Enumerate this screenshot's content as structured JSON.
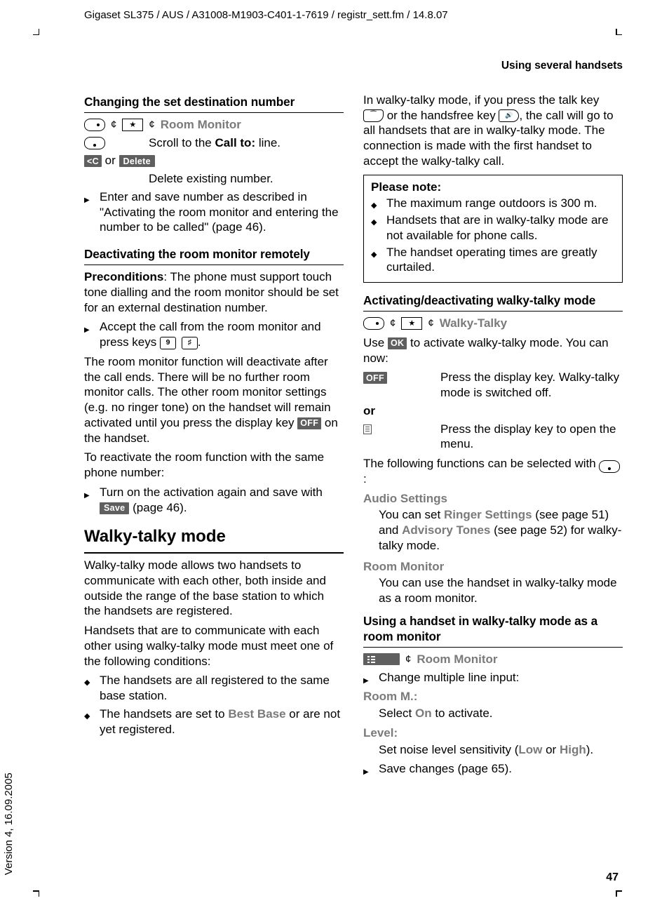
{
  "meta": {
    "topline": "Gigaset SL375 / AUS / A31008-M1903-C401-1-7619 / registr_sett.fm / 14.8.07",
    "sideline": "Version 4, 16.09.2005",
    "running_head": "Using several handsets",
    "page_number": "47"
  },
  "left": {
    "h_change": "Changing the set destination number",
    "nav1_dest": "Room Monitor",
    "scroll_text_a": "Scroll to the ",
    "scroll_text_b": "Call to:",
    "scroll_text_c": " line.",
    "or": " or ",
    "soft_delete": "Delete",
    "delete_text": "Delete existing number.",
    "step_enter": "Enter and save number as described in \"Activating the room monitor and entering the number to be called\" (page 46).",
    "h_deact": "Deactivating the room monitor remotely",
    "precond_label": "Preconditions",
    "precond_text": ": The phone must support touch tone dialling and the room monitor should be set for an external destination number.",
    "step_accept_a": "Accept the call from the room monitor and press keys ",
    "step_accept_b": ".",
    "para_deact": "The room monitor function will deactivate after the call ends. There will be no further room monitor calls. The other room monitor settings (e.g. no ringer tone) on the handset will remain activated until you press the display key ",
    "para_deact_suffix": " on the handset.",
    "para_react": "To reactivate the room function with the same phone number:",
    "step_turnon_a": "Turn on the activation again and save with ",
    "soft_save": "Save",
    "step_turnon_b": " (page 46).",
    "soft_off": "OFF",
    "h_walky": "Walky-talky mode",
    "para_allows": "Walky-talky mode allows two handsets to communicate with each other, both inside and outside the range of the base station to which the handsets are registered.",
    "para_cond": "Handsets that are to communicate with each other using walky-talky mode must meet one of the following conditions:",
    "bul_a": "The handsets are all registered to the same base station.",
    "bul_b_a": "The handsets are set to ",
    "bul_b_gray": "Best Base",
    "bul_b_b": " or are not yet registered."
  },
  "right": {
    "para_intro_a": "In walky-talky mode, if you press the talk key ",
    "para_intro_b": " or the handsfree key ",
    "para_intro_c": ", the call will go to all handsets that are in walky-talky mode. The connection is made with the first handset to accept the walky-talky call.",
    "note_title": "Please note:",
    "note_1": "The maximum range outdoors is 300 m.",
    "note_2": "Handsets that are in walky-talky mode are not available for phone calls.",
    "note_3": "The handset operating times are greatly curtailed.",
    "h_act": "Activating/deactivating walky-talky mode",
    "nav2_dest": "Walky-Talky",
    "use_a": "Use ",
    "soft_ok": "OK",
    "use_b": " to activate walky-talky mode. You can now:",
    "off_label": "OFF",
    "off_text": "Press the display key. Walky-talky mode is switched off.",
    "or": "or",
    "menu_text": "Press the display key to open the menu.",
    "follow_text": "The following functions can be selected with ",
    "follow_suffix": ":",
    "fn1_label": "Audio Settings",
    "fn1_a": "You can set ",
    "fn1_g1": "Ringer Settings",
    "fn1_b": " (see page 51) and ",
    "fn1_g2": "Advisory Tones",
    "fn1_c": "  (see page 52) for walky-talky mode.",
    "fn2_label": "Room Monitor",
    "fn2_text": "You can use the handset in walky-talky mode as a room monitor.",
    "h_use": "Using a handset in walky-talky mode as a room monitor",
    "nav3_dest": "Room Monitor",
    "step_change": "Change multiple line input:",
    "rm_label": "Room M.:",
    "rm_a": "Select ",
    "rm_g": "On",
    "rm_b": " to activate.",
    "lvl_label": "Level:",
    "lvl_a": "Set noise level sensitivity (",
    "lvl_g1": "Low",
    "lvl_b": " or ",
    "lvl_g2": "High",
    "lvl_c": ").",
    "step_save": "Save changes (page 65)."
  }
}
